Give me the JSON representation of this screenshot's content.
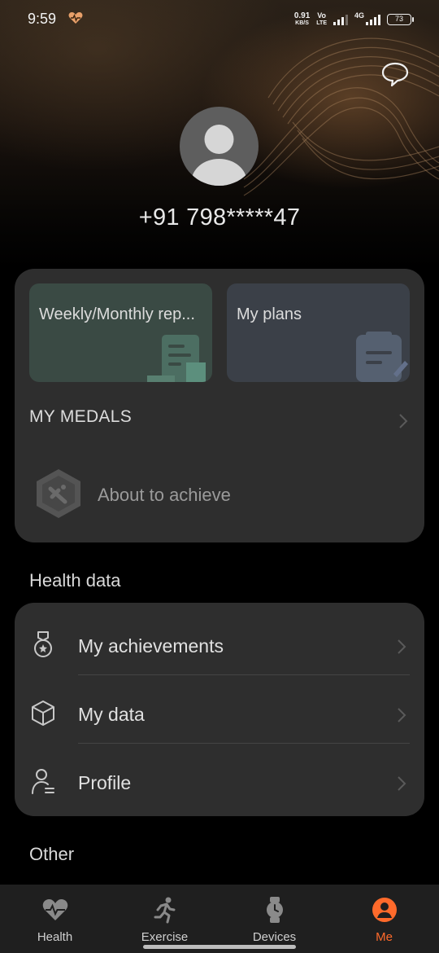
{
  "status_bar": {
    "time": "9:59",
    "net_speed_value": "0.91",
    "net_speed_unit": "KB/S",
    "volte_top": "Vo",
    "volte_bottom": "LTE",
    "network": "4G",
    "battery": "73"
  },
  "profile": {
    "phone": "+91 798*****47",
    "avatar_icon": "default-user-avatar-icon",
    "chat_icon": "chat-bubble-icon"
  },
  "quick_tiles": [
    {
      "label": "Weekly/Monthly rep...",
      "color": "#3a4a44",
      "icon": "report-document-icon"
    },
    {
      "label": "My plans",
      "color": "#3b4048",
      "icon": "plan-clipboard-icon"
    }
  ],
  "medals": {
    "title": "MY MEDALS",
    "item_text": "About to achieve",
    "badge_icon": "hexagon-medal-icon"
  },
  "health_data": {
    "title": "Health data",
    "items": [
      {
        "label": "My achievements",
        "icon": "medal-icon"
      },
      {
        "label": "My data",
        "icon": "cube-icon"
      },
      {
        "label": "Profile",
        "icon": "person-profile-icon"
      }
    ]
  },
  "other": {
    "title": "Other"
  },
  "bottom_nav": [
    {
      "label": "Health",
      "icon": "heart-pulse-icon",
      "active": false
    },
    {
      "label": "Exercise",
      "icon": "running-person-icon",
      "active": false
    },
    {
      "label": "Devices",
      "icon": "smartwatch-icon",
      "active": false
    },
    {
      "label": "Me",
      "icon": "person-circle-icon",
      "active": true
    }
  ],
  "colors": {
    "accent": "#ff6a2b",
    "card": "#2e2e2e",
    "nav_bg": "#1f1f1f"
  }
}
